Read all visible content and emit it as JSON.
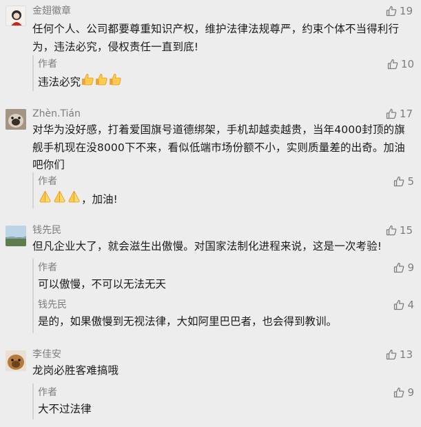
{
  "comments": [
    {
      "author": "金翅徽章",
      "likes": "19",
      "text": "任何个人、公司都要尊重知识产权，维护法律法规尊严，约束个体不当得利行为，违法必究，侵权责任一直到底!",
      "replies": [
        {
          "author": "作者",
          "likes": "10",
          "text": "违法必究",
          "emoji": "thumbs-up-icon ×3"
        }
      ]
    },
    {
      "author": "Zhèn.Tián",
      "likes": "17",
      "text": "对华为没好感，打着爱国旗号道德绑架，手机却越卖越贵，当年4000封顶的旗舰手机现在没8000下不来，看似低端市场份额不小，实则质量差的出奇。加油吧你们",
      "replies": [
        {
          "author": "作者",
          "likes": "5",
          "text": "，加油!",
          "emoji": "praying-hands-icon ×3"
        }
      ]
    },
    {
      "author": "钱先民",
      "likes": "15",
      "text": "但凡企业大了，就会滋生出傲慢。对国家法制化进程来说，这是一次考验!",
      "replies": [
        {
          "author": "作者",
          "likes": "9",
          "text": "可以傲慢，不可以无法无天"
        },
        {
          "author": "钱先民",
          "likes": "4",
          "text": "是的，如果傲慢到无视法律，大如阿里巴巴者，也会得到教训。"
        }
      ]
    },
    {
      "author": "李佳安",
      "likes": "13",
      "text": "龙岗必胜客难搞哦",
      "replies": [
        {
          "author": "作者",
          "likes": "9",
          "text": "大不过法律"
        }
      ]
    }
  ],
  "colors": {
    "background": "#ededed",
    "meta_text": "#7d7d7d",
    "body_text": "#1a1a1a",
    "reply_bar": "#d3d3d3"
  }
}
